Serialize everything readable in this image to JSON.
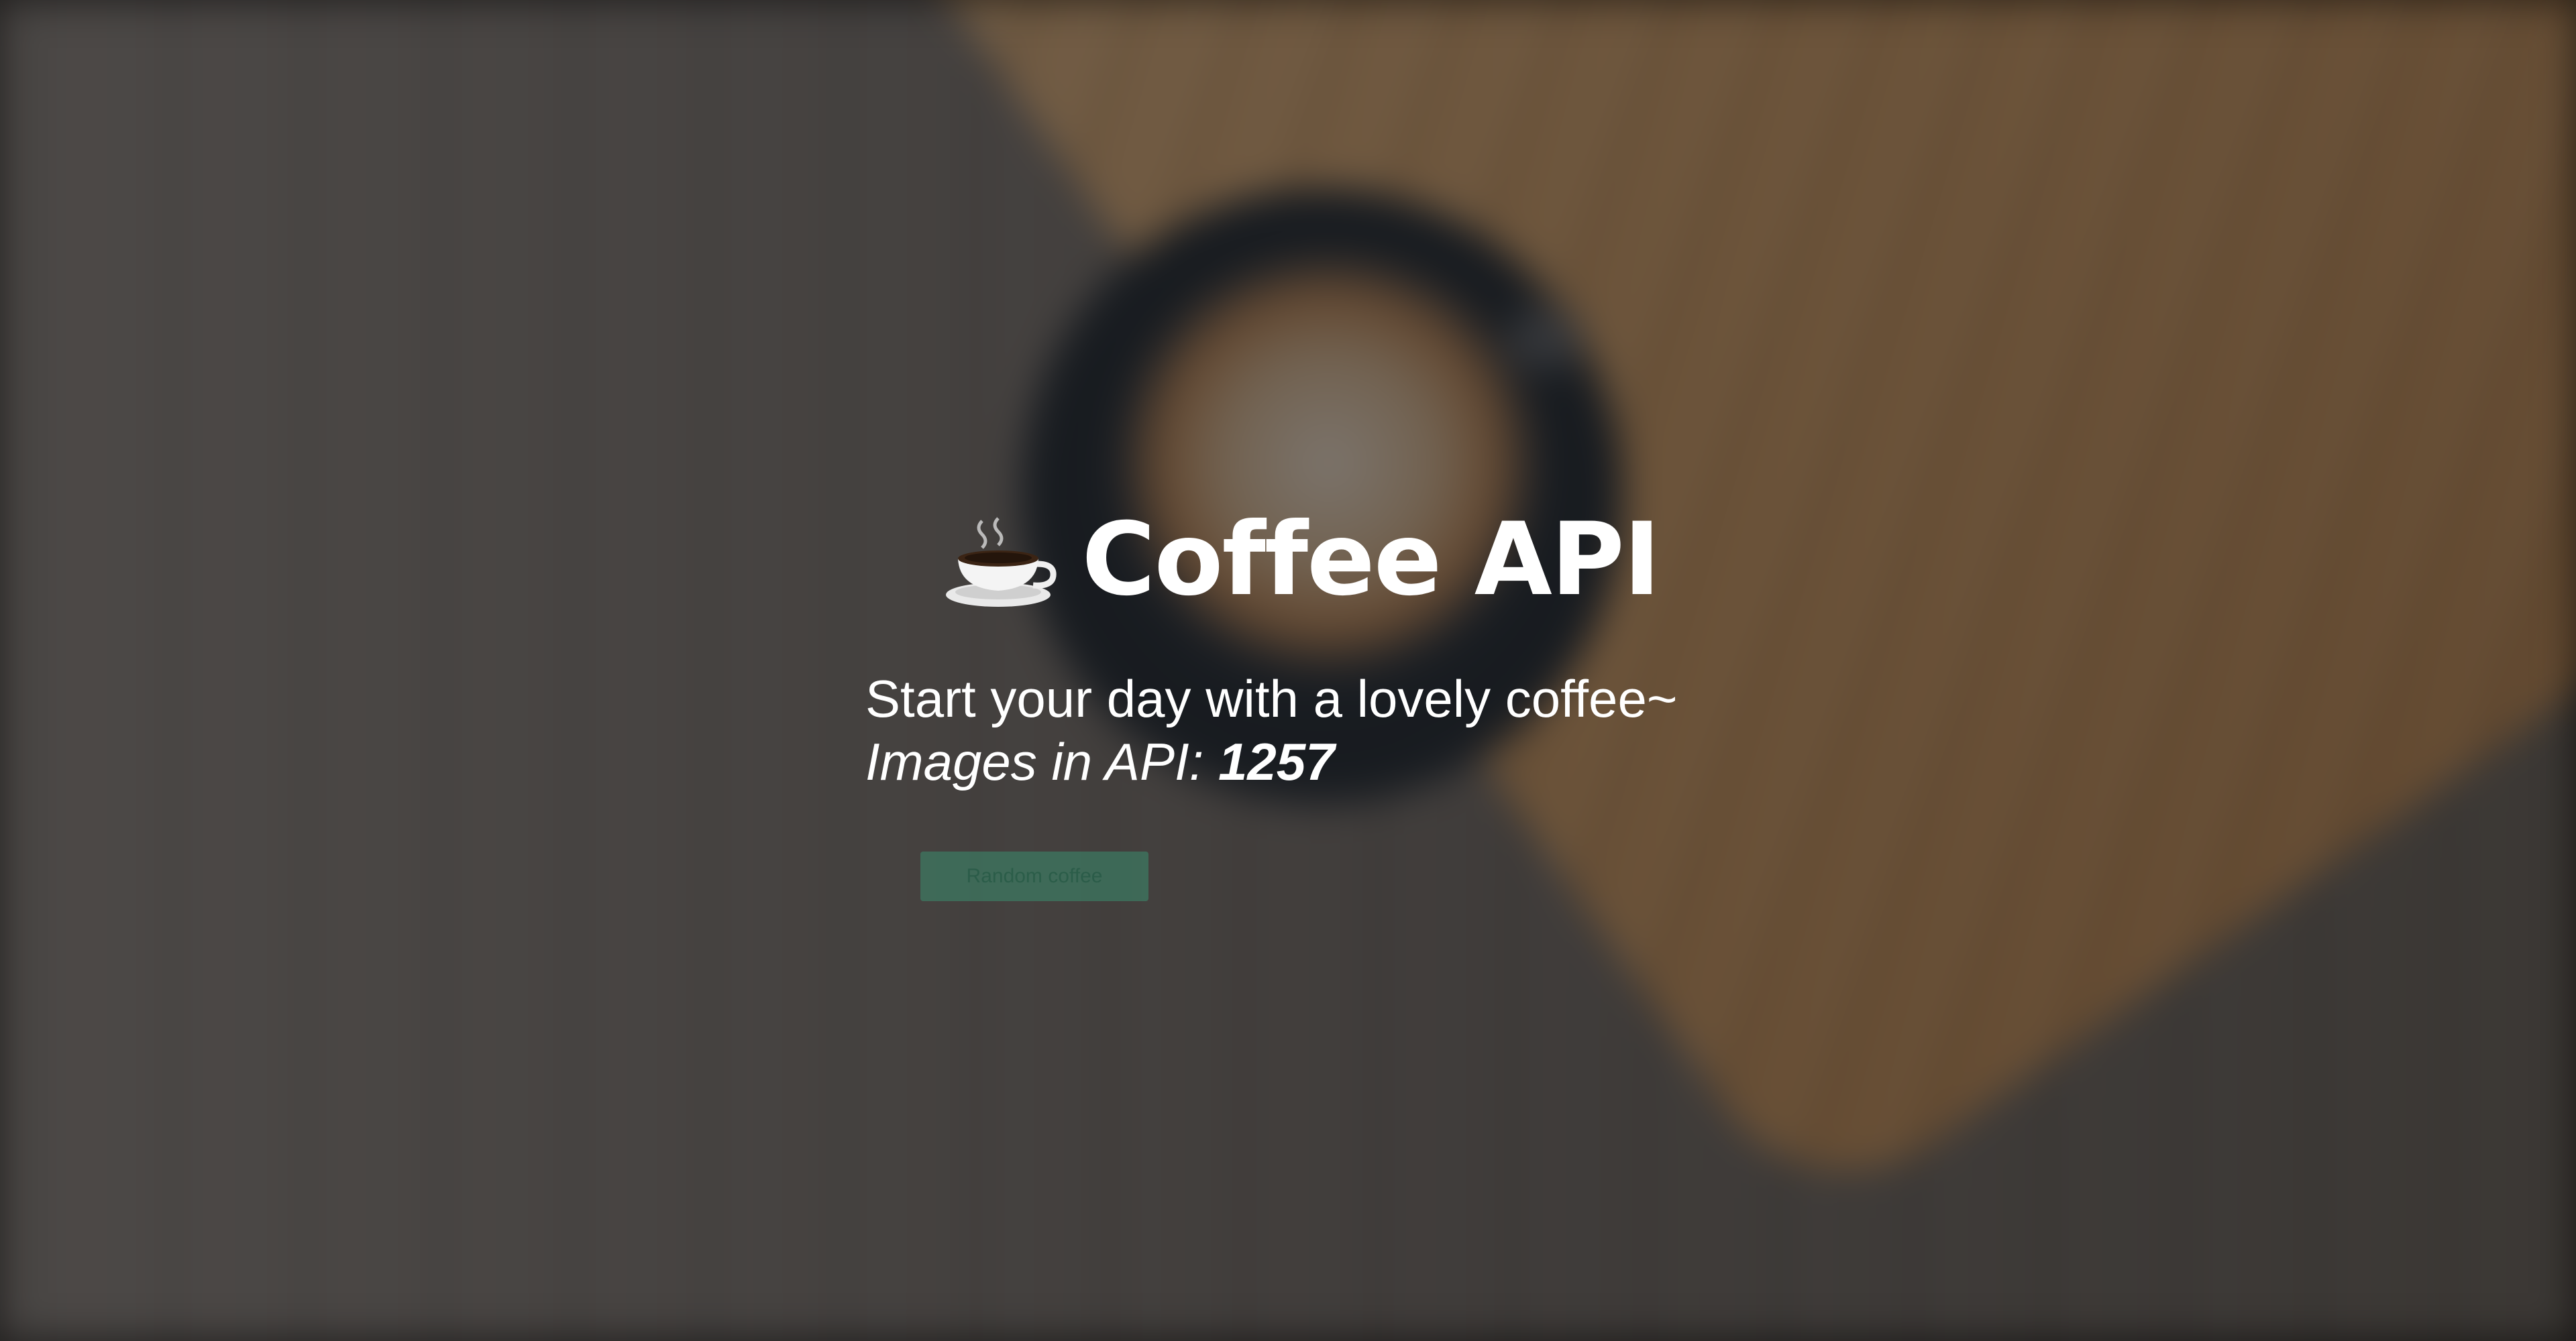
{
  "header": {
    "icon": "hot-beverage-icon",
    "title": "Coffee API"
  },
  "main": {
    "tagline": "Start your day with a lovely coffee~",
    "image_count_label": "Images in API: ",
    "image_count_value": "1257",
    "random_button_label": "Random coffee"
  },
  "colors": {
    "button_bg": "#3a8c6e",
    "text": "#ffffff",
    "overlay": "#0f0c0a"
  }
}
